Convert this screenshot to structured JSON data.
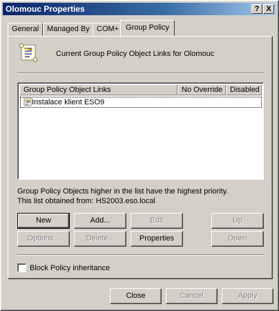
{
  "window": {
    "title": "Olomouc Properties",
    "help_label": "?",
    "close_label": "X"
  },
  "tabs": [
    {
      "label": "General"
    },
    {
      "label": "Managed By"
    },
    {
      "label": "COM+"
    },
    {
      "label": "Group Policy",
      "active": true
    }
  ],
  "header": {
    "text": "Current Group Policy Object Links for Olomouc"
  },
  "list": {
    "columns": [
      "Group Policy Object Links",
      "No Override",
      "Disabled"
    ],
    "items": [
      {
        "name": "Instalace klient ESO9"
      }
    ]
  },
  "info": {
    "line1": "Group Policy Objects higher in the list have the highest priority.",
    "line2": "This list obtained from: HS2003.eso.local"
  },
  "buttons": {
    "new": "New",
    "add": "Add...",
    "edit": "Edit",
    "up": "Up",
    "options": "Options...",
    "delete": "Delete...",
    "properties": "Properties",
    "down": "Down"
  },
  "block": {
    "label": "Block Policy inheritance",
    "checked": false
  },
  "footer": {
    "close": "Close",
    "cancel": "Cancel",
    "apply": "Apply"
  }
}
